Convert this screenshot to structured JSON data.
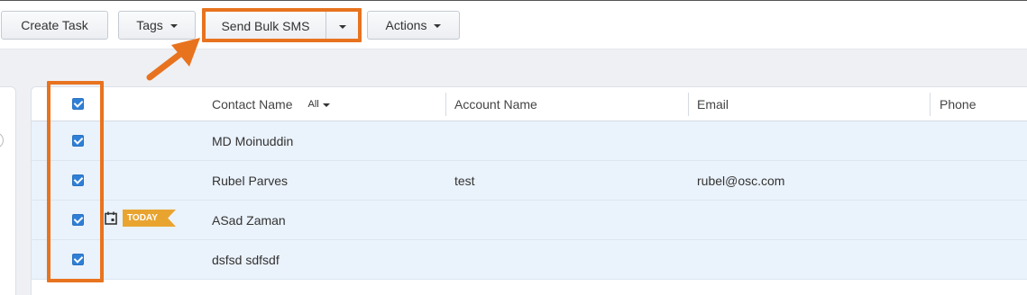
{
  "toolbar": {
    "create_task": "Create Task",
    "tags": "Tags",
    "send_bulk_sms": "Send Bulk SMS",
    "actions": "Actions"
  },
  "table": {
    "filter_label": "All",
    "columns": [
      "Contact Name",
      "Account Name",
      "Email",
      "Phone"
    ],
    "rows": [
      {
        "contact": "MD Moinuddin",
        "account": "",
        "email": "",
        "phone": "",
        "checked": true
      },
      {
        "contact": "Rubel Parves",
        "account": "test",
        "email": "rubel@osc.com",
        "phone": "",
        "checked": true
      },
      {
        "contact": "ASad Zaman",
        "account": "",
        "email": "",
        "phone": "",
        "checked": true,
        "badge": "TODAY"
      },
      {
        "contact": "dsfsd sdfsdf",
        "account": "",
        "email": "",
        "phone": "",
        "checked": true
      }
    ]
  },
  "colors": {
    "highlight": "#e8731f",
    "checkbox": "#2f7fd6",
    "row_bg": "#eaf2fb",
    "badge": "#e9a430"
  },
  "icons": {
    "calendar": "calendar-icon",
    "caret": "caret-down-icon",
    "arrow": "arrow-annotation"
  }
}
